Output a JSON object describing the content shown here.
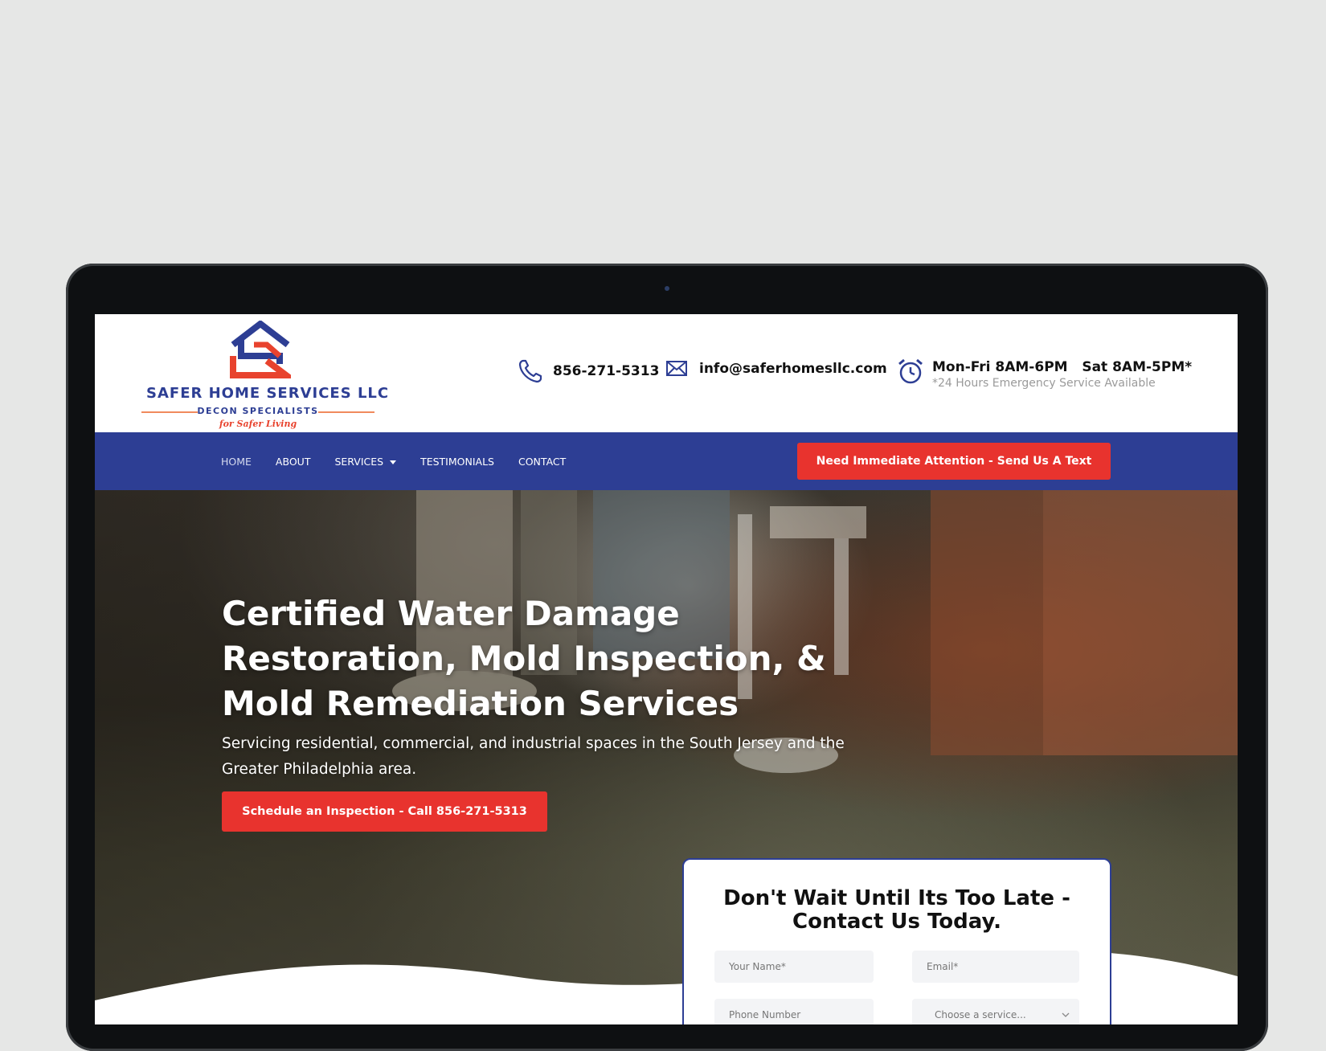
{
  "brand": {
    "name": "SAFER HOME SERVICES LLC",
    "subtitle": "DECON SPECIALISTS",
    "tagline": "for Safer Living",
    "colors": {
      "blue": "#2d3e94",
      "red": "#e8332e",
      "orange": "#e8432e"
    }
  },
  "contact": {
    "phone": "856-271-5313",
    "email": "info@saferhomesllc.com",
    "hours": "Mon-Fri 8AM-6PM   Sat 8AM-5PM*",
    "hours_note": "*24 Hours Emergency Service Available",
    "icons": {
      "phone": "phone-icon",
      "email": "envelope-icon",
      "hours": "alarm-clock-icon"
    }
  },
  "nav": {
    "items": [
      {
        "label": "HOME",
        "active": true
      },
      {
        "label": "ABOUT"
      },
      {
        "label": "SERVICES"
      },
      {
        "label": "TESTIMONIALS"
      },
      {
        "label": "CONTACT"
      }
    ],
    "cta": "Need Immediate Attention - Send Us A Text"
  },
  "hero": {
    "title": "Certified Water Damage Restoration, Mold Inspection, & Mold Remediation Services",
    "subtitle": "Servicing residential, commercial, and industrial spaces in the South Jersey and the Greater Philadelphia area.",
    "cta": "Schedule an Inspection - Call 856-271-5313"
  },
  "form": {
    "title": "Don't Wait Until Its Too Late - Contact Us Today.",
    "name_placeholder": "Your Name*",
    "email_placeholder": "Email*",
    "phone_placeholder": "Phone Number",
    "service_selected": "Choose a service..."
  }
}
